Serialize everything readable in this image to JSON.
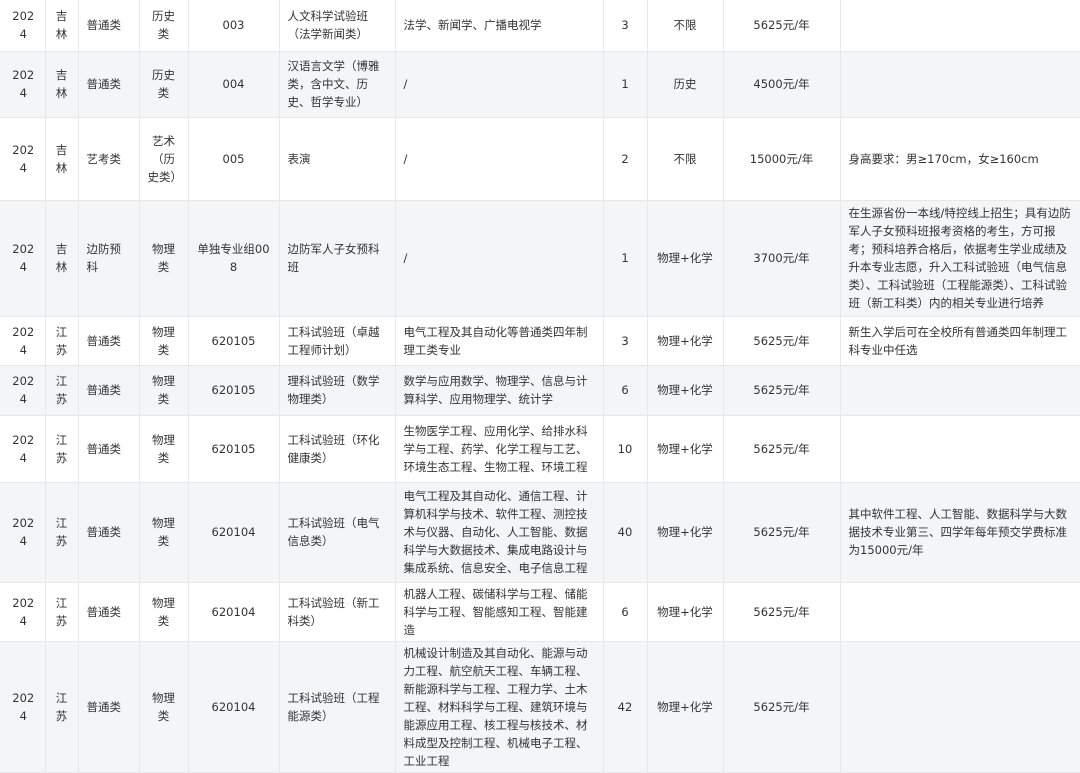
{
  "rows": [
    [
      "2024",
      "吉林",
      "普通类",
      "历史类",
      "003",
      "人文科学试验班（法学新闻类）",
      "法学、新闻学、广播电视学",
      "3",
      "不限",
      "5625元/年",
      ""
    ],
    [
      "2024",
      "吉林",
      "普通类",
      "历史类",
      "004",
      "汉语言文学（博雅类，含中文、历史、哲学专业）",
      "/",
      "1",
      "历史",
      "4500元/年",
      ""
    ],
    [
      "2024",
      "吉林",
      "艺考类",
      "艺术（历史类）",
      "005",
      "表演",
      "/",
      "2",
      "不限",
      "15000元/年",
      "身高要求：男≥170cm，女≥160cm"
    ],
    [
      "2024",
      "吉林",
      "边防预科",
      "物理类",
      "单独专业组008",
      "边防军人子女预科班",
      "/",
      "1",
      "物理+化学",
      "3700元/年",
      "在生源省份一本线/特控线上招生；具有边防军人子女预科班报考资格的考生，方可报考；预科培养合格后，依据考生学业成绩及升本专业志愿，升入工科试验班（电气信息类）、工科试验班（工程能源类）、工科试验班（新工科类）内的相关专业进行培养"
    ],
    [
      "2024",
      "江苏",
      "普通类",
      "物理类",
      "620105",
      "工科试验班（卓越工程师计划）",
      "电气工程及其自动化等普通类四年制理工类专业",
      "3",
      "物理+化学",
      "5625元/年",
      "新生入学后可在全校所有普通类四年制理工科专业中任选"
    ],
    [
      "2024",
      "江苏",
      "普通类",
      "物理类",
      "620105",
      "理科试验班（数学物理类）",
      "数学与应用数学、物理学、信息与计算科学、应用物理学、统计学",
      "6",
      "物理+化学",
      "5625元/年",
      ""
    ],
    [
      "2024",
      "江苏",
      "普通类",
      "物理类",
      "620105",
      "工科试验班（环化健康类）",
      "生物医学工程、应用化学、给排水科学与工程、药学、化学工程与工艺、环境生态工程、生物工程、环境工程",
      "10",
      "物理+化学",
      "5625元/年",
      ""
    ],
    [
      "2024",
      "江苏",
      "普通类",
      "物理类",
      "620104",
      "工科试验班（电气信息类）",
      "电气工程及其自动化、通信工程、计算机科学与技术、软件工程、测控技术与仪器、自动化、人工智能、数据科学与大数据技术、集成电路设计与集成系统、信息安全、电子信息工程",
      "40",
      "物理+化学",
      "5625元/年",
      "其中软件工程、人工智能、数据科学与大数据技术专业第三、四学年每年预交学费标准为15000元/年"
    ],
    [
      "2024",
      "江苏",
      "普通类",
      "物理类",
      "620104",
      "工科试验班（新工科类）",
      "机器人工程、碳储科学与工程、储能科学与工程、智能感知工程、智能建造",
      "6",
      "物理+化学",
      "5625元/年",
      ""
    ],
    [
      "2024",
      "江苏",
      "普通类",
      "物理类",
      "620104",
      "工科试验班（工程能源类）",
      "机械设计制造及其自动化、能源与动力工程、航空航天工程、车辆工程、新能源科学与工程、工程力学、土木工程、材料科学与工程、建筑环境与能源应用工程、核工程与核技术、材料成型及控制工程、机械电子工程、工业工程",
      "42",
      "物理+化学",
      "5625元/年",
      ""
    ]
  ]
}
